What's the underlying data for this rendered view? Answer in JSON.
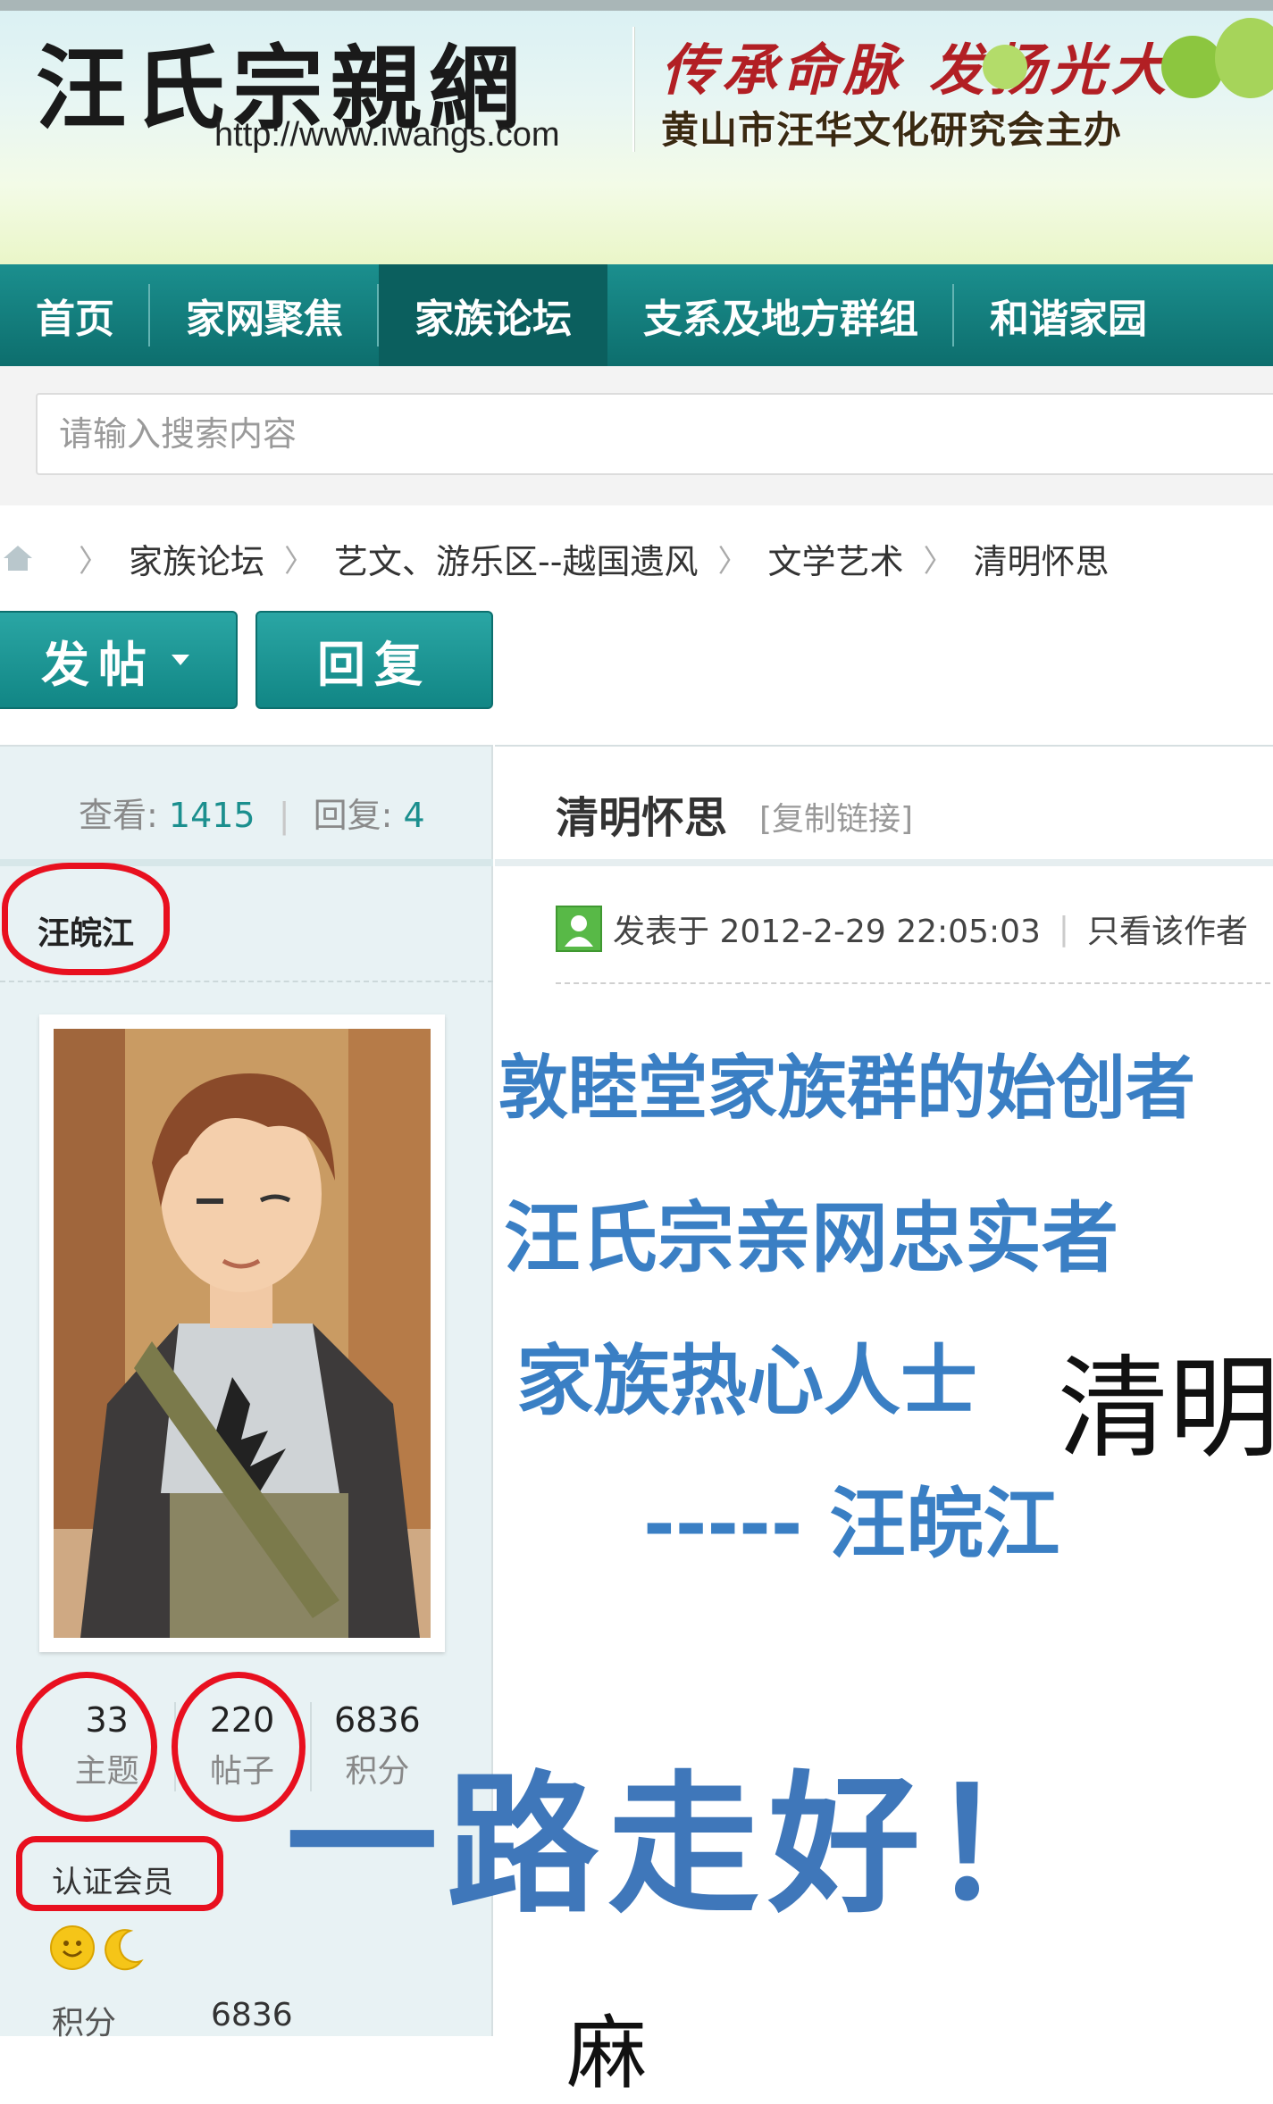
{
  "header": {
    "site_title": "汪氏宗親網",
    "url": "http://www.iwangs.com",
    "slogan": "传承命脉 发扬光大",
    "subtitle": "黄山市汪华文化研究会主办"
  },
  "nav": {
    "items": [
      {
        "label": "首页"
      },
      {
        "label": "家网聚焦"
      },
      {
        "label": "家族论坛"
      },
      {
        "label": "支系及地方群组"
      },
      {
        "label": "和谐家园"
      }
    ]
  },
  "search": {
    "placeholder": "请输入搜索内容"
  },
  "breadcrumb": {
    "items": [
      {
        "label": "家族论坛"
      },
      {
        "label": "艺文、游乐区--越国遗风"
      },
      {
        "label": "文学艺术"
      },
      {
        "label": "清明怀思"
      }
    ]
  },
  "actions": {
    "post_label": "发帖",
    "reply_label": "回复"
  },
  "thread": {
    "views_label": "查看:",
    "views": "1415",
    "replies_label": "回复:",
    "replies": "4",
    "title": "清明怀思",
    "copy_link": "[复制链接]",
    "posted_at": "发表于 2012-2-29 22:05:03",
    "only_author": "只看该作者"
  },
  "author": {
    "name": "汪皖江",
    "stats": [
      {
        "num": "33",
        "label": "主题"
      },
      {
        "num": "220",
        "label": "帖子"
      },
      {
        "num": "6836",
        "label": "积分"
      }
    ],
    "badge": "认证会员",
    "score_label": "积分",
    "score_value": "6836"
  },
  "post_image": {
    "line1": "敦睦堂家族群的始创者",
    "line2": "汪氏宗亲网忠实者",
    "line3": "家族热心人士",
    "line3_black": "清明",
    "line4": "----- 汪皖江",
    "line5": "一路走好！",
    "bottom_fragment": "麻"
  },
  "colors": {
    "nav_bg": "#137f7e",
    "accent_teal": "#1b8f8e",
    "highlight_red": "#e8101f",
    "image_text_blue": "#3a7fc4"
  }
}
